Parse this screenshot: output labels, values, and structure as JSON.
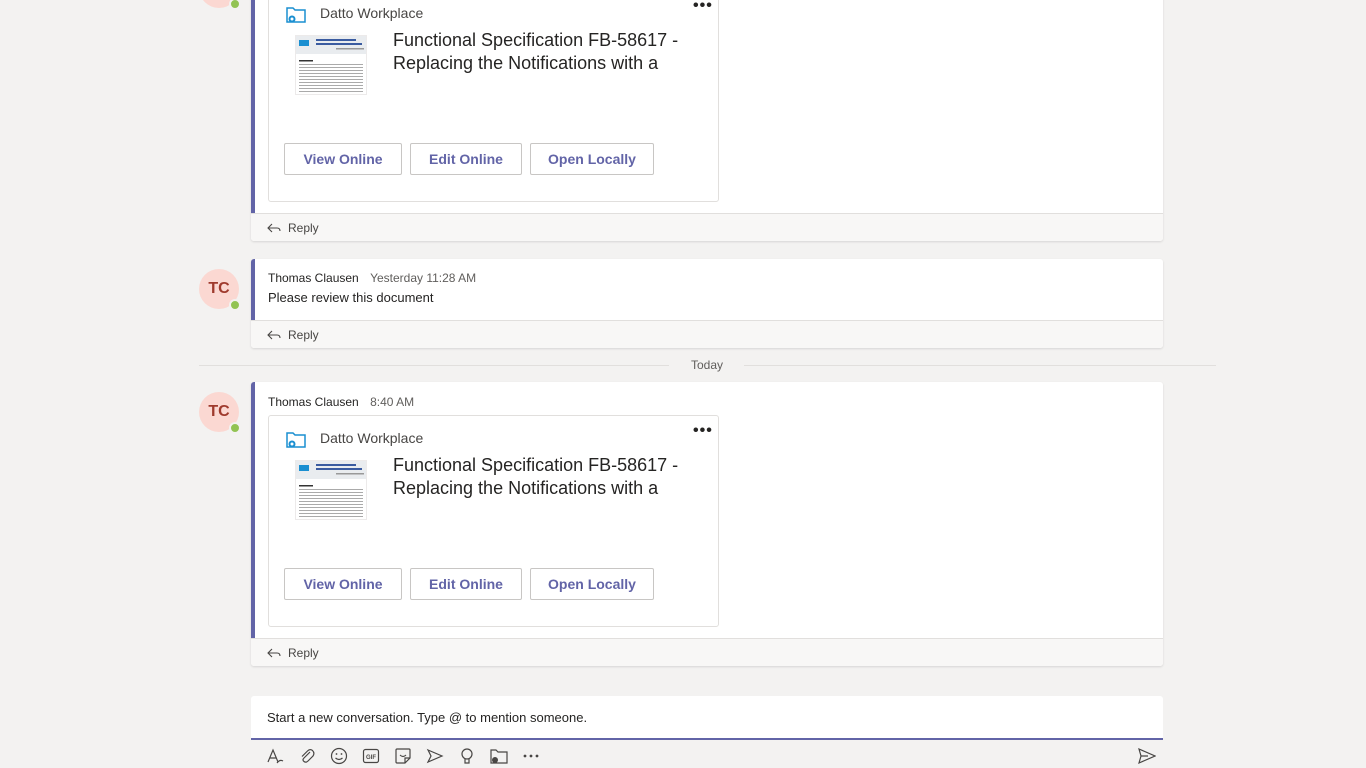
{
  "messages": [
    {
      "card": {
        "app_name": "Datto Workplace",
        "more_label": "•••",
        "title": "Functional Specification FB-58617 - Replacing the Notifications with a",
        "buttons": [
          "View Online",
          "Edit Online",
          "Open Locally"
        ]
      },
      "reply_label": "Reply"
    },
    {
      "avatar_initials": "TC",
      "author": "Thomas Clausen",
      "time": "Yesterday 11:28 AM",
      "text": "Please review this document",
      "reply_label": "Reply"
    },
    {
      "avatar_initials": "TC",
      "author": "Thomas Clausen",
      "time": "8:40 AM",
      "card": {
        "app_name": "Datto Workplace",
        "more_label": "•••",
        "title": "Functional Specification FB-58617 - Replacing the Notifications with a",
        "buttons": [
          "View Online",
          "Edit Online",
          "Open Locally"
        ]
      },
      "reply_label": "Reply"
    }
  ],
  "divider": {
    "label": "Today"
  },
  "compose": {
    "placeholder": "Start a new conversation. Type @ to mention someone."
  },
  "toolbar": {
    "icons": [
      "format-icon",
      "attach-icon",
      "emoji-icon",
      "gif-icon",
      "sticker-icon",
      "meet-icon",
      "praise-icon",
      "datto-workplace-icon",
      "more-options-icon",
      "send-icon"
    ]
  },
  "colors": {
    "accent": "#6264a7",
    "presence_available": "#92c353",
    "avatar_bg": "#fbd8d2",
    "avatar_text": "#9f3a2d"
  }
}
